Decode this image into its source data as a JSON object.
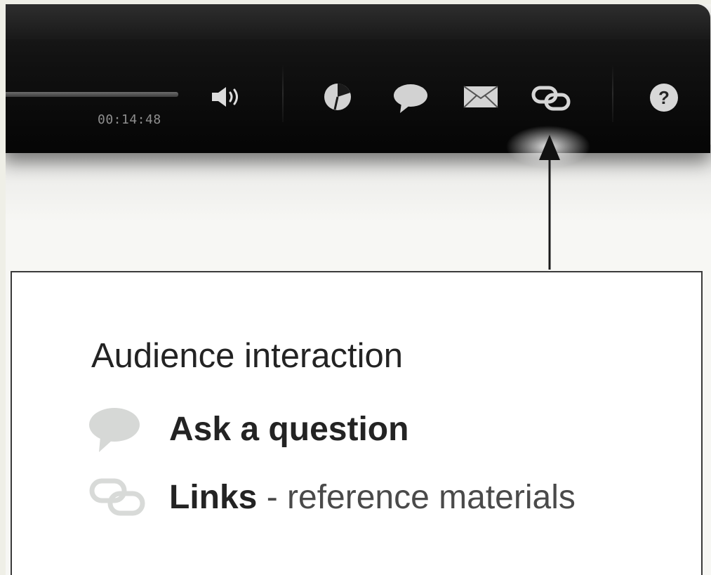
{
  "player": {
    "time_elapsed": "00:14:48",
    "controls": [
      {
        "name": "volume-icon"
      },
      {
        "name": "poll-icon"
      },
      {
        "name": "chat-icon"
      },
      {
        "name": "email-icon"
      },
      {
        "name": "links-icon"
      },
      {
        "name": "help-icon"
      }
    ]
  },
  "callout": {
    "title": "Audience interaction",
    "items": [
      {
        "icon": "speech-bubble-icon",
        "label": "Ask a question",
        "desc": ""
      },
      {
        "icon": "chain-link-icon",
        "label": "Links",
        "desc": " - reference materials"
      }
    ]
  },
  "colors": {
    "toolbar_bg": "#111111",
    "icon_gray": "#cfcfcf",
    "callout_icon": "#d6d8d6",
    "text": "#232323"
  }
}
